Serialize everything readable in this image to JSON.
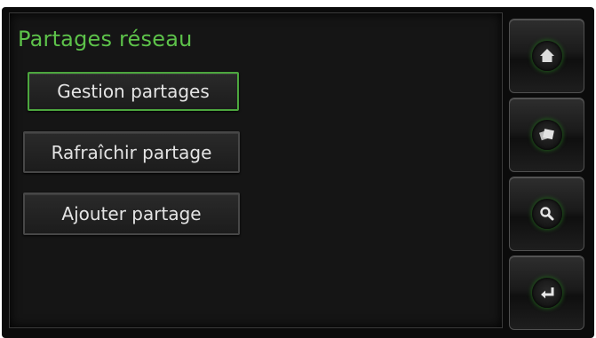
{
  "screen": {
    "title": "Partages réseau"
  },
  "menu": {
    "items": [
      {
        "label": "Gestion partages",
        "selected": true
      },
      {
        "label": "Rafraîchir partage",
        "selected": false
      },
      {
        "label": "Ajouter partage",
        "selected": false
      }
    ]
  },
  "sidebar": {
    "buttons": [
      {
        "icon": "home-icon"
      },
      {
        "icon": "cards-icon"
      },
      {
        "icon": "search-icon"
      },
      {
        "icon": "back-icon"
      }
    ]
  },
  "colors": {
    "accent": "#5dc24a",
    "selected_border": "#4ca63e",
    "background": "#0b0b0b",
    "text": "#e4e4e4"
  }
}
